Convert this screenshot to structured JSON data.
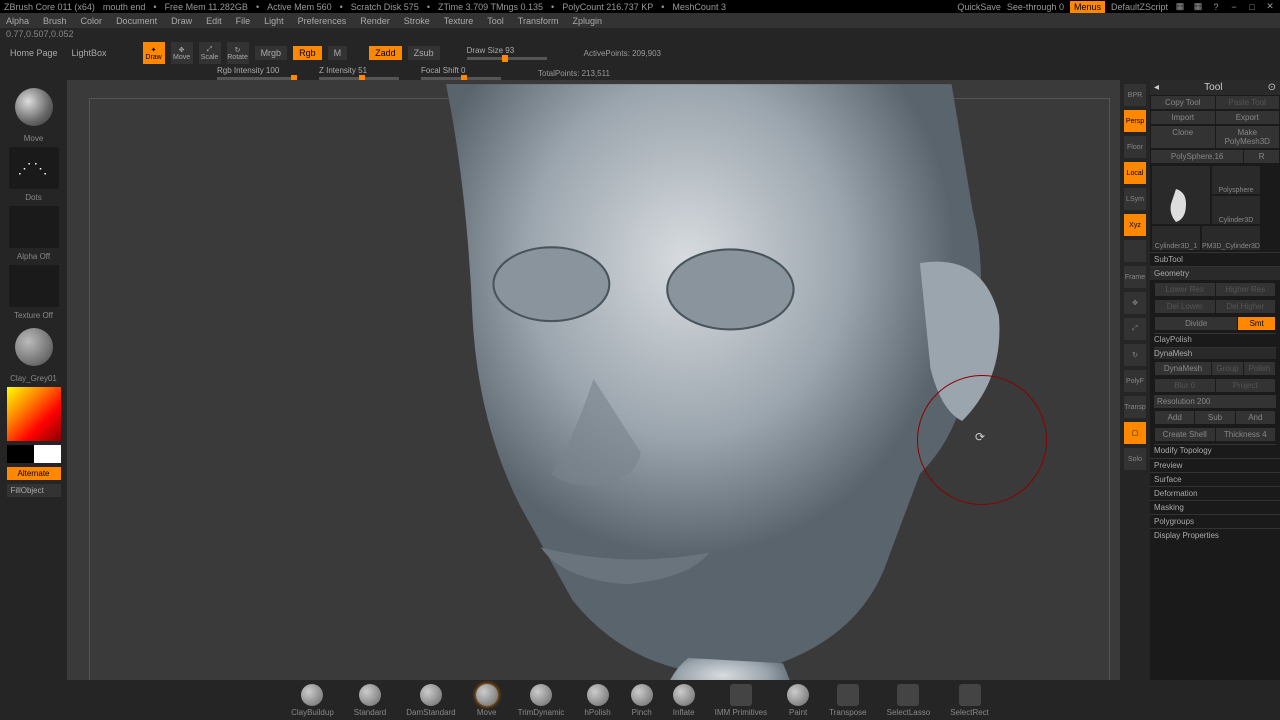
{
  "title": {
    "app": "ZBrush Core 011 (x64)",
    "doc": "mouth end",
    "freemem": "Free Mem 11.282GB",
    "activemem": "Active Mem 560",
    "scratch": "Scratch Disk 575",
    "ztime": "ZTime 3.709 TMngs 0.135",
    "polycount": "PolyCount 216.737 KP",
    "meshcount": "MeshCount 3",
    "quicksave": "QuickSave",
    "seethrough": "See-through  0",
    "menus": "Menus",
    "script": "DefaultZScript"
  },
  "menu": [
    "Alpha",
    "Brush",
    "Color",
    "Document",
    "Draw",
    "Edit",
    "File",
    "Light",
    "Preferences",
    "Render",
    "Stroke",
    "Texture",
    "Tool",
    "Transform",
    "Zplugin"
  ],
  "info": "0.77,0.507,0.052",
  "tabs": {
    "home": "Home Page",
    "lightbox": "LightBox"
  },
  "modes": {
    "draw": "Draw",
    "move": "Move",
    "scale": "Scale",
    "rotate": "Rotate"
  },
  "color_modes": {
    "mrgb": "Mrgb",
    "rgb": "Rgb",
    "m": "M",
    "zadd": "Zadd",
    "zsub": "Zsub"
  },
  "sliders": {
    "rgb_intensity": "Rgb Intensity 100",
    "z_intensity": "Z Intensity 51",
    "draw_size": "Draw Size 93",
    "focal_shift": "Focal Shift 0"
  },
  "stats": {
    "active": "ActivePoints: 209,903",
    "total": "TotalPoints: 213,511"
  },
  "left": {
    "move": "Move",
    "dots": "Dots",
    "alpha_off": "Alpha Off",
    "texture_off": "Texture Off",
    "clay": "Clay_Grey01",
    "alternate": "Alternate",
    "fillobject": "FillObject"
  },
  "right_icons": [
    "BPR",
    "Persp",
    "Floor",
    "Local",
    "LSym",
    "Xyz",
    "",
    "Frame",
    "",
    "",
    "PolyF",
    "",
    "Transp",
    "",
    "Solo"
  ],
  "tool": {
    "title": "Tool",
    "copy": "Copy Tool",
    "paste": "Paste Tool",
    "import": "Import",
    "export": "Export",
    "clone": "Clone",
    "make": "Make PolyMesh3D",
    "polysphere": "PolySphere.16",
    "r": "R",
    "thumbs": [
      "PolySphere",
      "Polysphere",
      "Cylinder3D",
      "Cylinder3D_1",
      "PM3D_Cylinder3D"
    ],
    "sections": {
      "subtool": "SubTool",
      "geometry": "Geometry",
      "lower_res": "Lower Res",
      "higher_res": "Higher Res",
      "del_lower": "Del Lower",
      "del_higher": "Del Higher",
      "divide": "Divide",
      "smt": "Smt",
      "claypolish": "ClayPolish",
      "dynamesh": "DynaMesh",
      "dynamesh_btn": "DynaMesh",
      "group": "Group",
      "polish": "Polish",
      "blur": "Blur 0",
      "project": "Project",
      "resolution": "Resolution 200",
      "add": "Add",
      "sub": "Sub",
      "and": "And",
      "create_shell": "Create Shell",
      "thickness": "Thickness 4",
      "modify_topo": "Modify Topology",
      "preview": "Preview",
      "surface": "Surface",
      "deformation": "Deformation",
      "masking": "Masking",
      "polygroups": "Polygroups",
      "display": "Display Properties"
    }
  },
  "bottom": [
    "ClayBuildup",
    "Standard",
    "DamStandard",
    "Move",
    "TrimDynamic",
    "hPolish",
    "Pinch",
    "Inflate",
    "IMM Primitives",
    "Paint",
    "Transpose",
    "SelectLasso",
    "SelectRect"
  ]
}
